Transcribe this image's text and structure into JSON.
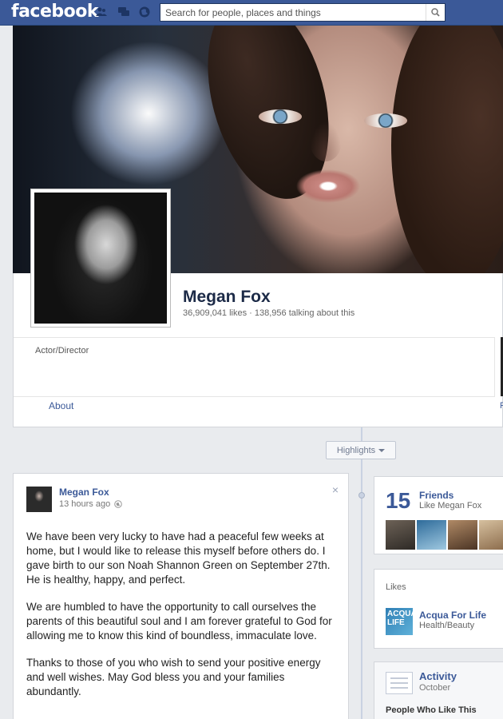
{
  "topbar": {
    "logo": "facebook",
    "search_placeholder": "Search for people, places and things"
  },
  "page": {
    "name": "Megan Fox",
    "stats": "36,909,041 likes · 138,956 talking about this",
    "category": "Actor/Director",
    "about_label": "About",
    "right_edge_letter": "F"
  },
  "timeline": {
    "highlights_label": "Highlights"
  },
  "post": {
    "author": "Megan Fox",
    "time": "13 hours ago",
    "close_symbol": "×",
    "paragraphs": [
      "We have been very lucky to have had a peaceful few weeks at home, but I would like to release this myself before others do. I gave birth to our son Noah Shannon Green on September 27th. He is healthy, happy, and perfect.",
      "We are humbled to have the opportunity to call ourselves the parents of this beautiful soul and I am forever grateful to God for allowing me to know this kind of boundless, immaculate love.",
      "Thanks to those of you who wish to send your positive energy and well wishes. May God bless you and your families abundantly."
    ]
  },
  "friends": {
    "count": "15",
    "title": "Friends",
    "subtitle": "Like Megan Fox"
  },
  "likes": {
    "title": "Likes",
    "item_logo_text": "ACQUA LIFE",
    "item_name": "Acqua For Life",
    "item_category": "Health/Beauty"
  },
  "activity": {
    "title": "Activity",
    "subtitle": "October",
    "people_like": "People Who Like This"
  },
  "colors": {
    "brand": "#3b5998",
    "link": "#3b5998",
    "background": "#e9ebee"
  }
}
